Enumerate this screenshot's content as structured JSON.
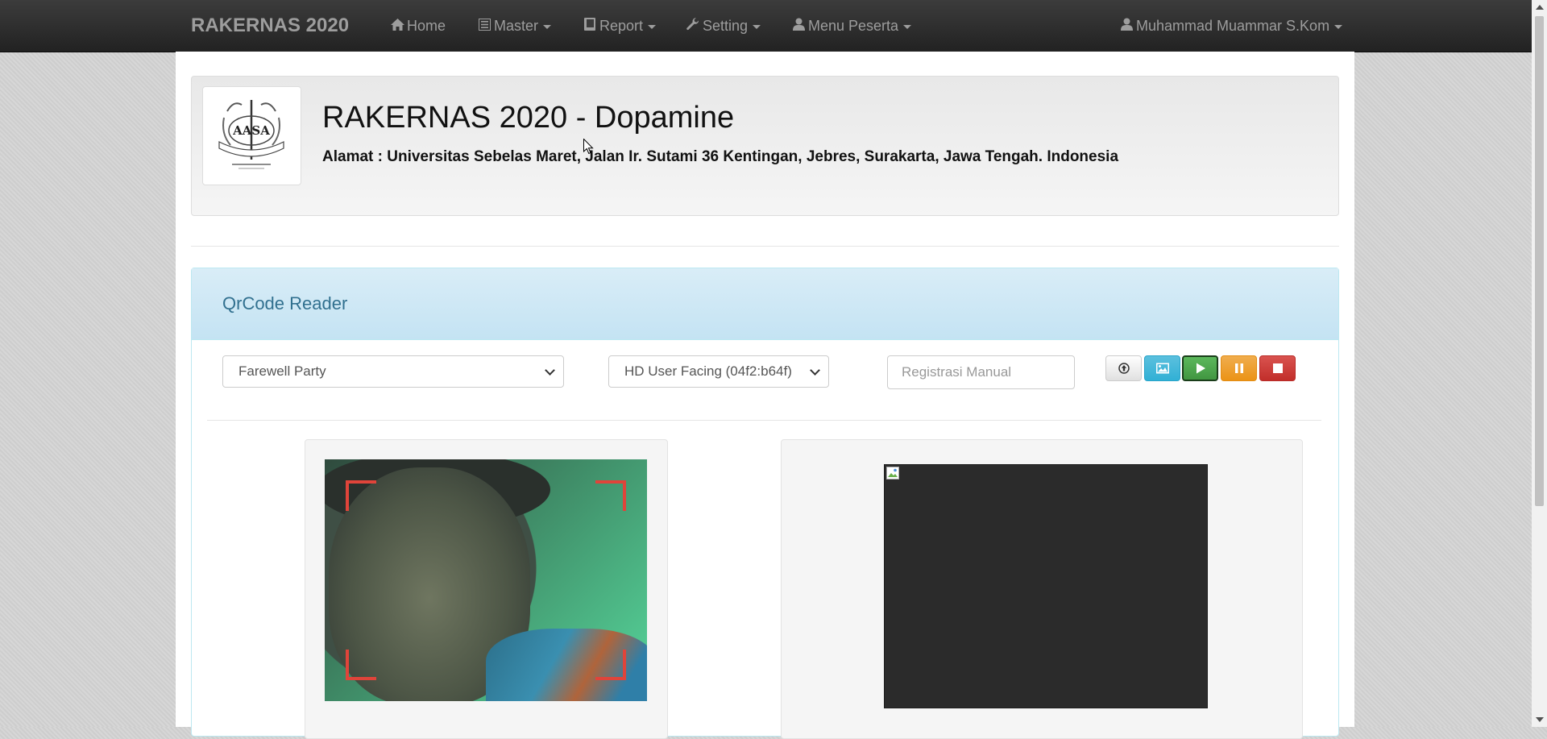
{
  "navbar": {
    "brand": "RAKERNAS 2020",
    "items": [
      {
        "label": "Home",
        "icon": "home-icon"
      },
      {
        "label": "Master",
        "icon": "list-icon"
      },
      {
        "label": "Report",
        "icon": "book-icon"
      },
      {
        "label": "Setting",
        "icon": "wrench-icon"
      },
      {
        "label": "Menu Peserta",
        "icon": "user-icon"
      }
    ],
    "user": {
      "label": "Muhammad Muammar S.Kom",
      "icon": "user-icon"
    }
  },
  "header": {
    "logo_text": "AASA",
    "title": "RAKERNAS 2020 - Dopamine",
    "address": "Alamat : Universitas Sebelas Maret, Jalan Ir. Sutami 36 Kentingan, Jebres, Surakarta, Jawa Tengah. Indonesia"
  },
  "qr_panel": {
    "title": "QrCode Reader",
    "event_select": {
      "selected": "Farewell Party"
    },
    "camera_select": {
      "selected": "HD User Facing (04f2:b64f)"
    },
    "manual_input": {
      "placeholder": "Registrasi Manual",
      "value": ""
    },
    "buttons": [
      {
        "name": "upload-button",
        "icon": "upload-icon"
      },
      {
        "name": "image-button",
        "icon": "image-icon"
      },
      {
        "name": "play-button",
        "icon": "play-icon",
        "active": true
      },
      {
        "name": "pause-button",
        "icon": "pause-icon"
      },
      {
        "name": "stop-button",
        "icon": "stop-icon"
      }
    ]
  },
  "colors": {
    "navbar": "#222222",
    "panel_heading": "#d9edf7",
    "panel_title": "#31708f",
    "scanner_corners": "#e0443a"
  }
}
